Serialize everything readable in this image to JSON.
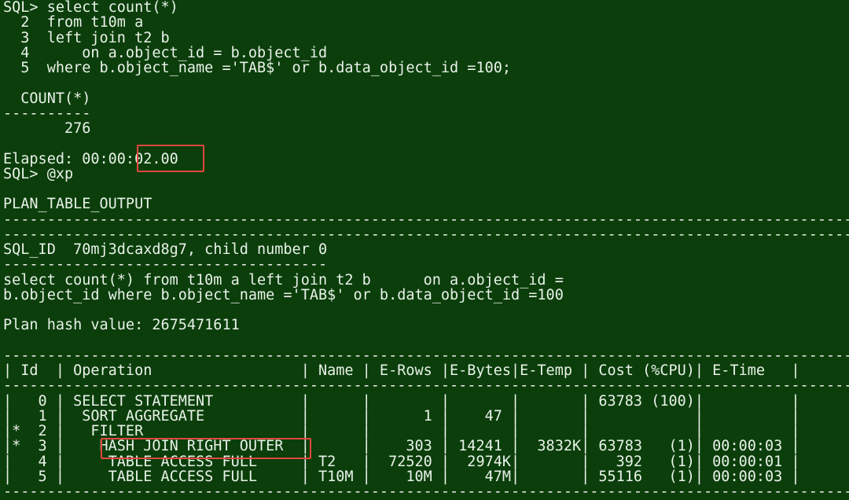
{
  "terminal": {
    "lines": [
      "SQL> select count(*)",
      "  2  from t10m a",
      "  3  left join t2 b",
      "  4      on a.object_id = b.object_id",
      "  5  where b.object_name ='TAB$' or b.data_object_id =100;",
      "",
      "  COUNT(*)",
      "----------",
      "       276",
      "",
      "Elapsed: 00:00:02.00",
      "SQL> @xp",
      "",
      "PLAN_TABLE_OUTPUT",
      "--------------------------------------------------------------------------------------------------------------",
      "--------------------------------------------------------------------------------------------------------------",
      "SQL_ID  70mj3dcaxd8g7, child number 0",
      "-------------------------------------",
      "select count(*) from t10m a left join t2 b      on a.object_id =",
      "b.object_id where b.object_name ='TAB$' or b.data_object_id =100",
      "",
      "Plan hash value: 2675471611",
      "",
      "--------------------------------------------------------------------------------------------------------------",
      "| Id  | Operation                 | Name | E-Rows |E-Bytes|E-Temp | Cost (%CPU)| E-Time   |",
      "--------------------------------------------------------------------------------------------------------------",
      "|   0 | SELECT STATEMENT          |      |        |       |       | 63783 (100)|          |",
      "|   1 |  SORT AGGREGATE           |      |      1 |    47 |       |            |          |",
      "|*  2 |   FILTER                  |      |        |       |       |            |          |",
      "|*  3 |    HASH JOIN RIGHT OUTER  |      |    303 | 14241 |  3832K| 63783   (1)| 00:00:03 |",
      "|   4 |     TABLE ACCESS FULL     | T2   |  72520 |  2974K|       |   392   (1)| 00:00:01 |",
      "|   5 |     TABLE ACCESS FULL     | T10M |    10M |    47M|       | 55116   (1)| 00:00:03 |",
      "--------------------------------------------------------------------------------------------------------------"
    ]
  }
}
